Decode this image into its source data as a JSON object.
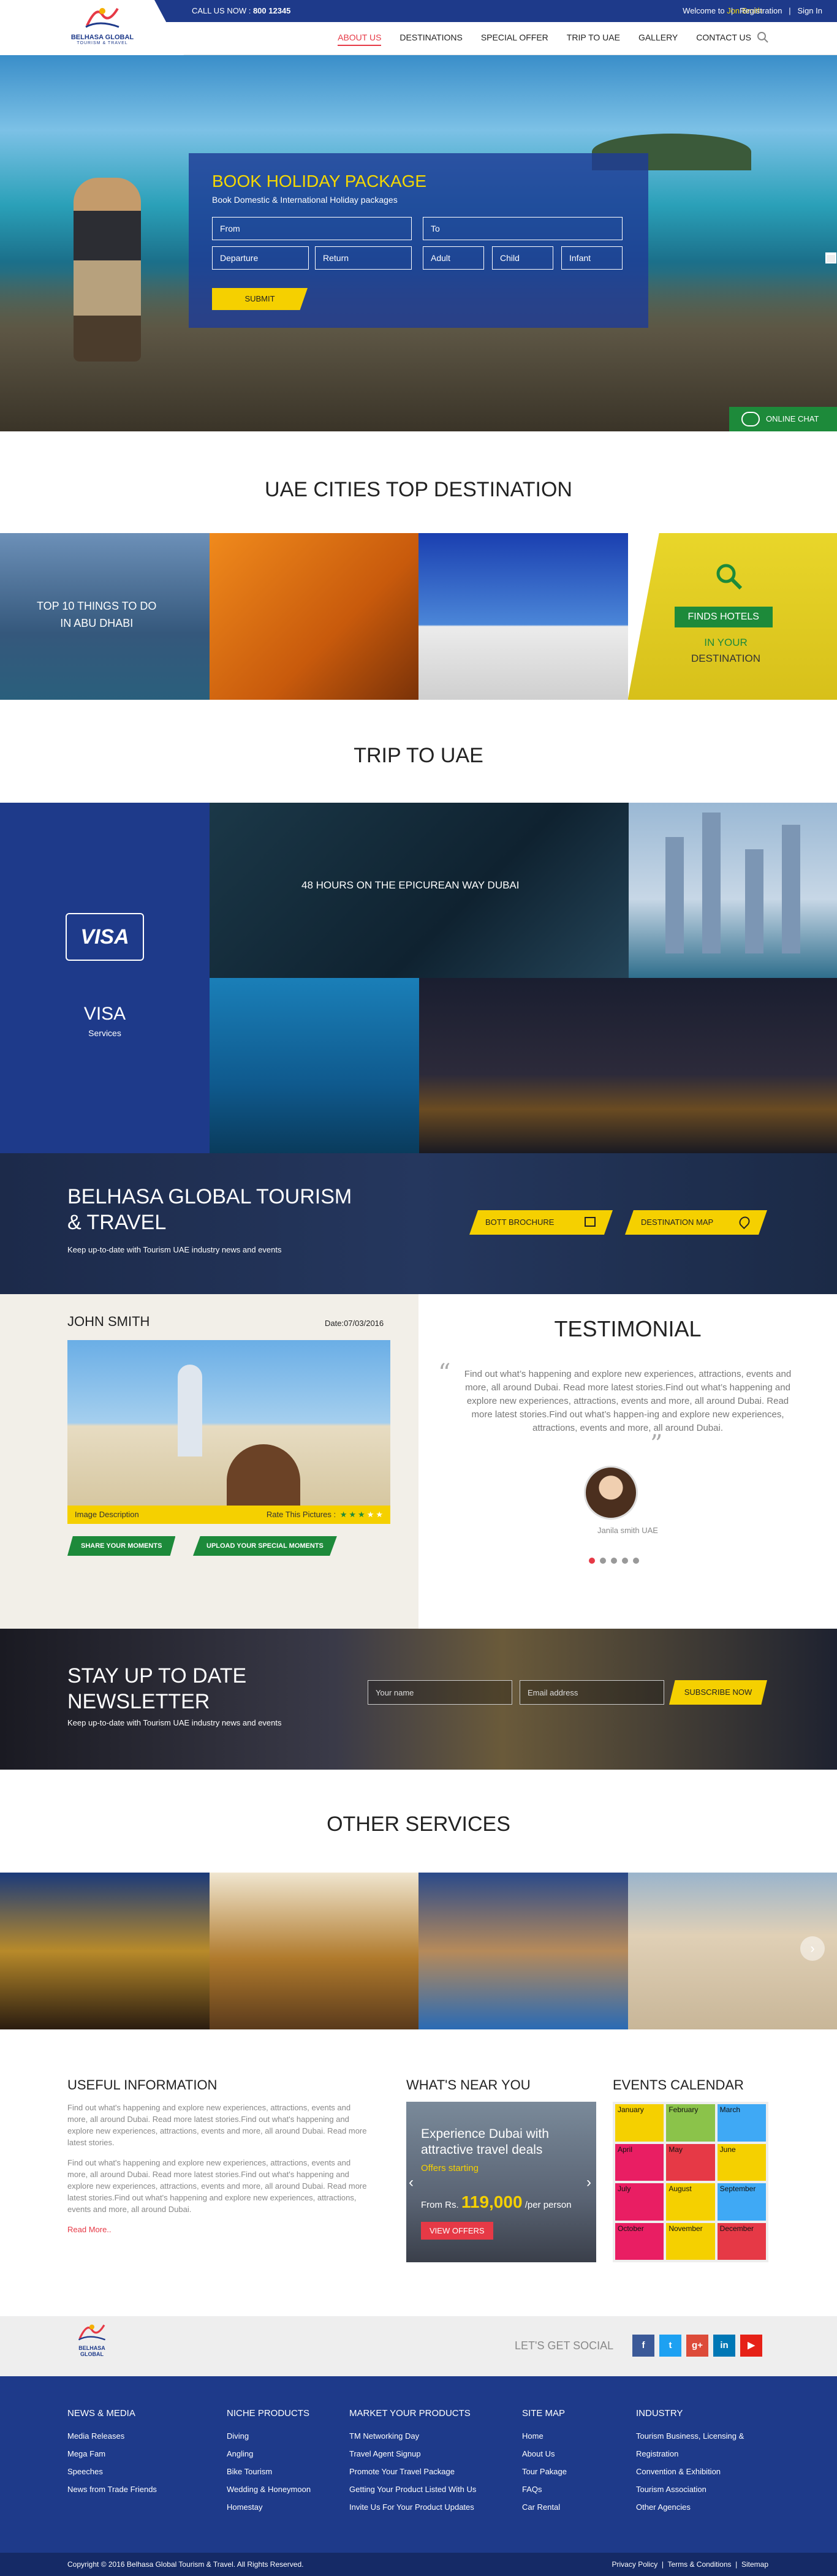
{
  "topbar": {
    "call_label": "CALL US NOW :",
    "phone": "800 12345",
    "welcome": "Welcome to",
    "user": "Jon Smith",
    "registration": "Registration",
    "sign_in": "Sign In",
    "sep": "|"
  },
  "logo": {
    "name": "BELHASA GLOBAL",
    "tagline": "TOURISM & TRAVEL"
  },
  "nav": [
    "ABOUT US",
    "DESTINATIONS",
    "SPECIAL OFFER",
    "TRIP TO UAE",
    "GALLERY",
    "CONTACT US"
  ],
  "booking": {
    "title": "BOOK HOLIDAY PACKAGE",
    "subtitle": "Book Domestic & International Holiday packages",
    "from": "From",
    "to": "To",
    "departure": "Departure",
    "return": "Return",
    "adult": "Adult",
    "child": "Child",
    "infant": "Infant",
    "submit": "SUBMIT"
  },
  "chat": "ONLINE CHAT",
  "dest": {
    "title": "UAE CITIES TOP DESTINATION",
    "tile1": "TOP 10 THINGS TO DO\nIN ABU DHABI",
    "finds": "FINDS HOTELS",
    "in_your": "IN YOUR",
    "destination": "DESTINATION"
  },
  "trip": {
    "title": "TRIP TO UAE",
    "visa_logo": "VISA",
    "visa": "VISA",
    "services": "Services",
    "epicurean": "48 HOURS ON THE EPICUREAN WAY DUBAI"
  },
  "band": {
    "title_1": "BELHASA GLOBAL TOURISM",
    "title_2": "& TRAVEL",
    "text": "Keep up-to-date with Tourism UAE industry news and events",
    "brochure": "BOTT BROCHURE",
    "map": "DESTINATION MAP"
  },
  "moments": {
    "name": "JOHN SMITH",
    "date": "Date:07/03/2016",
    "image_desc": "Image Description",
    "rate": "Rate This Pictures :",
    "share": "SHARE YOUR MOMENTS",
    "upload": "UPLOAD YOUR SPECIAL MOMENTS",
    "rating": 3,
    "rating_max": 5
  },
  "testimonial": {
    "title": "TESTIMONIAL",
    "quote": "Find out what’s happening and explore new experiences, attractions, events and more, all around Dubai. Read more latest stories.Find out what’s happening and explore new experiences, attractions, events and more, all around Dubai. Read more latest stories.Find out what’s happen-ing and explore new experiences, attractions, events and more, all around Dubai.",
    "author": "Janila smith UAE",
    "slide_count": 5,
    "active_slide": 1
  },
  "newsletter": {
    "title_1": "STAY UP TO DATE",
    "title_2": "NEWSLETTER",
    "text": "Keep up-to-date with Tourism UAE industry news and events",
    "name_ph": "Your name",
    "email_ph": "Email address",
    "subscribe": "SUBSCRIBE NOW"
  },
  "services": {
    "title": "OTHER SERVICES"
  },
  "useful": {
    "title": "USEFUL INFORMATION",
    "p1": "Find out what's happening and explore new experiences, attractions, events and more, all around Dubai. Read more latest stories.Find out what's happening and explore new experiences, attractions, events and more, all around Dubai. Read more latest stories.",
    "p2": "Find out what's happening and explore new experiences, attractions, events and more, all around Dubai. Read more latest stories.Find out what's happening and explore new experiences, attractions, events and more, all around Dubai. Read more latest stories.Find out what's happening and explore new experiences, attractions, events and more, all around Dubai.",
    "read_more": "Read More.."
  },
  "near": {
    "title": "WHAT'S NEAR YOU",
    "line1": "Experience Dubai with",
    "line2": "attractive travel deals",
    "offers": "Offers starting",
    "from": "From Rs.",
    "price": "119,000",
    "per": "/per person",
    "view": "VIEW OFFERS"
  },
  "calendar": {
    "title": "EVENTS CALENDAR",
    "months": [
      "January",
      "February",
      "March",
      "April",
      "May",
      "June",
      "July",
      "August",
      "September",
      "October",
      "November",
      "December"
    ]
  },
  "social": {
    "label": "LET'S GET SOCIAL",
    "icons": [
      "f",
      "t",
      "g+",
      "in",
      "▶"
    ]
  },
  "footer": {
    "news": {
      "title": "NEWS & MEDIA",
      "items": [
        "Media Releases",
        "Mega Fam",
        "Speeches",
        "News from Trade Friends"
      ]
    },
    "niche": {
      "title": "NICHE PRODUCTS",
      "items": [
        "Diving",
        "Angling",
        "Bike Tourism",
        "Wedding & Honeymoon",
        "Homestay"
      ]
    },
    "market": {
      "title": "MARKET YOUR PRODUCTS",
      "items": [
        "TM Networking Day",
        "Travel Agent Signup",
        "Promote Your Travel Package",
        "Getting Your Product Listed With Us",
        "Invite Us For Your Product Updates"
      ]
    },
    "sitemap": {
      "title": "SITE MAP",
      "items": [
        "Home",
        "About Us",
        "Tour Pakage",
        "FAQs",
        "Car Rental"
      ]
    },
    "industry": {
      "title": "INDUSTRY",
      "items": [
        "Tourism Business, Licensing &",
        "Registration",
        "Convention & Exhibition",
        "Tourism Association",
        "Other Agencies"
      ]
    }
  },
  "copyright": "Copyright © 2016 Belhasa Global Tourism & Travel. All Rights Reserved.",
  "bottom_links": {
    "privacy": "Privacy Policy",
    "terms": "Terms & Conditions",
    "sitemap": "Sitemap",
    "sep": "|"
  },
  "colors": {
    "primary": "#1e3a8a",
    "accent": "#f5d000",
    "green": "#1d8a3a",
    "red": "#e63946"
  }
}
